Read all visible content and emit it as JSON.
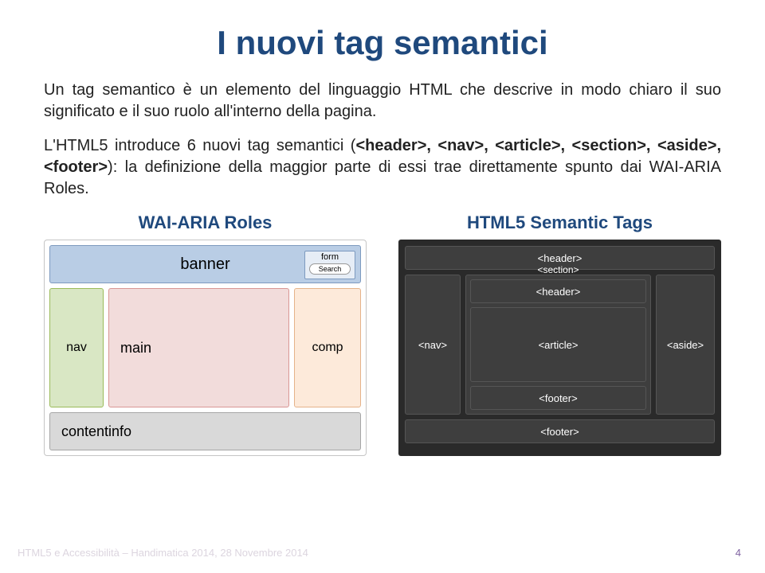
{
  "title": "I nuovi tag semantici",
  "para1": "Un tag semantico è un elemento del linguaggio HTML che descrive in modo chiaro il suo significato e il suo ruolo all'interno della pagina.",
  "para2_pre": "L'HTML5 introduce 6 nuovi tag semantici (",
  "tags_bold": "<header>, <nav>, <article>, <section>, <aside>, <footer>",
  "para2_post": "): la definizione della maggior parte di essi trae direttamente spunto dai WAI-ARIA Roles.",
  "left_heading": "WAI-ARIA Roles",
  "right_heading": "HTML5 Semantic Tags",
  "aria": {
    "banner": "banner",
    "form": "form",
    "search": "Search",
    "nav": "nav",
    "main": "main",
    "comp": "comp",
    "contentinfo": "contentinfo"
  },
  "h5": {
    "header": "<header>",
    "nav": "<nav>",
    "section": "<section>",
    "inner_header": "<header>",
    "article": "<article>",
    "inner_footer": "<footer>",
    "aside": "<aside>",
    "footer": "<footer>"
  },
  "footer": "HTML5 e Accessibilità – Handimatica 2014, 28 Novembre 2014",
  "page_num": "4"
}
